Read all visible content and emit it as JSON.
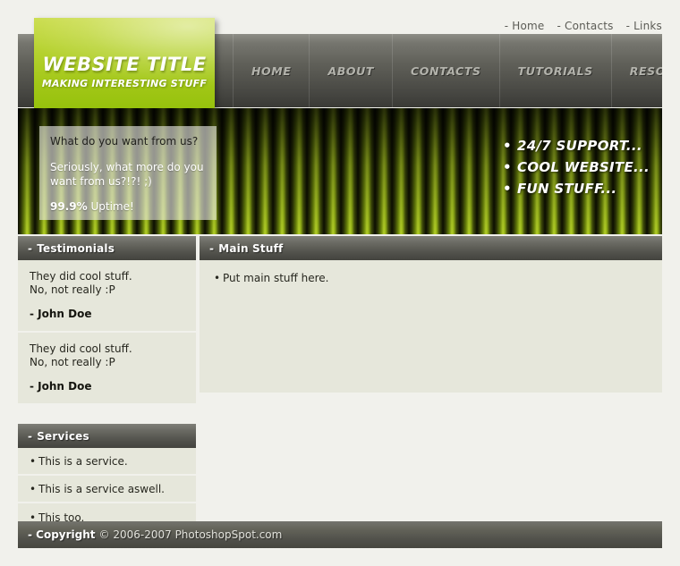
{
  "toplinks": {
    "items": [
      {
        "label": "- Home"
      },
      {
        "label": "- Contacts"
      },
      {
        "label": "- Links"
      }
    ]
  },
  "logo": {
    "title": "WEBSITE TITLE",
    "subtitle": "MAKING INTERESTING STUFF"
  },
  "nav": {
    "items": [
      {
        "label": "HOME"
      },
      {
        "label": "ABOUT"
      },
      {
        "label": "CONTACTS"
      },
      {
        "label": "TUTORIALS"
      },
      {
        "label": "RESOURCES"
      }
    ]
  },
  "banner": {
    "question": "What do you want from us?",
    "answer": "Seriously, what more do you want from us?!?! ;)",
    "uptime_value": "99.9%",
    "uptime_label": "Uptime!",
    "features": [
      {
        "label": "24/7 SUPPORT..."
      },
      {
        "label": "COOL WEBSITE..."
      },
      {
        "label": "FUN STUFF..."
      }
    ]
  },
  "testimonials": {
    "heading_dash": "-",
    "heading": "Testimonials",
    "items": [
      {
        "line1": "They did cool stuff.",
        "line2": "No, not really :P",
        "author": "- John Doe"
      },
      {
        "line1": "They did cool stuff.",
        "line2": "No, not really :P",
        "author": "- John Doe"
      }
    ]
  },
  "main": {
    "heading_dash": "-",
    "heading": "Main Stuff",
    "items": [
      {
        "label": "Put main stuff here."
      }
    ]
  },
  "services": {
    "heading_dash": "-",
    "heading": "Services",
    "items": [
      {
        "label": "This is a service."
      },
      {
        "label": "This is a service aswell."
      },
      {
        "label": "This too."
      }
    ]
  },
  "footer": {
    "dash_label": "- Copyright",
    "text": "© 2006-2007 PhotoshopSpot.com"
  },
  "colors": {
    "page_background": "#f1f1ec",
    "content_background": "#e6e7db",
    "accent_green": "#a2c717",
    "header_dark": "#43433e"
  }
}
